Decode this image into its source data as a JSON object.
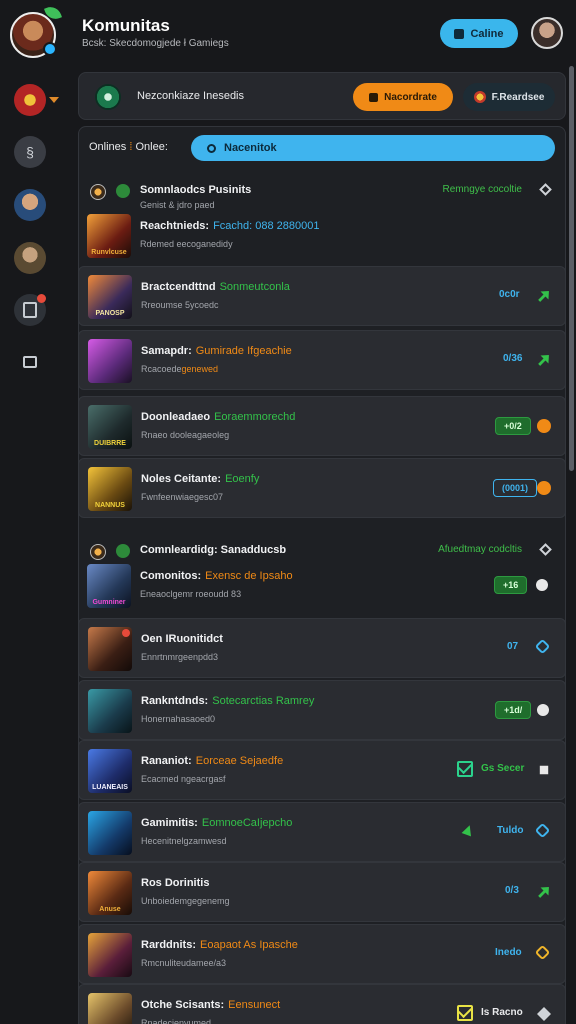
{
  "header": {
    "title": "Komunitas",
    "subtitle": "Bcsk: Skecdomogjede ł Gamiegs",
    "online_button": "Caline"
  },
  "notification": {
    "text": "Nezconkiaze Inesedis",
    "orange_button": "Nacordrate",
    "dark_button": "F.Reardsee"
  },
  "filter": {
    "label_left": "Onlines",
    "label_right": "Onlee:",
    "search_placeholder": "Nacenitok"
  },
  "section_1": {
    "head_title": "Somnlaodcs Pusinits",
    "head_sub": "Genist & jdro paed",
    "head_right": "Remngye cocoltie"
  },
  "section_2": {
    "head_title": "Comnleardidg: Sanadducsb",
    "head_right": "Afuedtmay codcltis"
  },
  "rows": [
    {
      "title": "Reachtnieds:",
      "title2": "Fcachd: 088 2880001",
      "sub": "Rdemed eecoganedidy",
      "thumb_caption": "Runvlcuse"
    },
    {
      "title": "Bractcendttnd",
      "title2": "Sonmeutconla",
      "sub": "Rreoumse 5ycoedc",
      "value": "0c0r",
      "thumb_caption": "PANOSP"
    },
    {
      "title": "Samapdr:",
      "title2": "Gumirade Ifgeachie",
      "sub": "Rcacoede",
      "sub_hl": "genewed",
      "value": "0/36",
      "thumb_caption": ""
    },
    {
      "title": "Doonleadaeo",
      "title2": "Eoraemmorechd",
      "sub": "Rnaeo dooleagaeoleg",
      "value": "+0/2",
      "thumb_caption": "DUIBRRE"
    },
    {
      "title": "Noles Ceitante:",
      "title2": "Eoenfy",
      "sub": "Fwnfeenwiaegesc07",
      "value": "(0001)",
      "thumb_caption": "NANNUS"
    },
    {
      "title": "Comonitos:",
      "title2": "Exensc de Ipsaho",
      "sub": "Eneaoclgemr roeoudd 83",
      "value": "+16",
      "thumb_caption": "Gumniner"
    },
    {
      "title": "Oen IRuonitidct",
      "title2": "",
      "sub": "Ennrtnmrgeenpdd3",
      "value": "07",
      "thumb_caption": ""
    },
    {
      "title": "Rankntdnds:",
      "title2": "Sotecarctias Ramrey",
      "sub": "Honernahasaoed0",
      "value": "+1d/",
      "thumb_caption": ""
    },
    {
      "title": "Rananiot:",
      "title2": "Eorceae Sejaedfe",
      "sub": "Ecacmed ngeacrgasf",
      "value": "Gs Secer",
      "thumb_caption": "LUANEAIS"
    },
    {
      "title": "Gamimitis:",
      "title2": "EomnoeCaIjepcho",
      "sub": "Hecenitnelgzamwesd",
      "value": "Tuldo",
      "thumb_caption": ""
    },
    {
      "title": "Ros Dorinitis",
      "title2": "",
      "sub": "Unboiedemgegenemg",
      "value": "0/3",
      "thumb_caption": "Anuse"
    },
    {
      "title": "Rarddnits:",
      "title2": "Eoapaot As Ipasche",
      "sub": "Rmcnuliteudamee/a3",
      "value": "Inedo",
      "thumb_caption": ""
    },
    {
      "title": "Otche Scisants:",
      "title2": "Eensunect",
      "sub": "Rnadecienvumed",
      "value": "Is Racno",
      "thumb_caption": ""
    }
  ]
}
